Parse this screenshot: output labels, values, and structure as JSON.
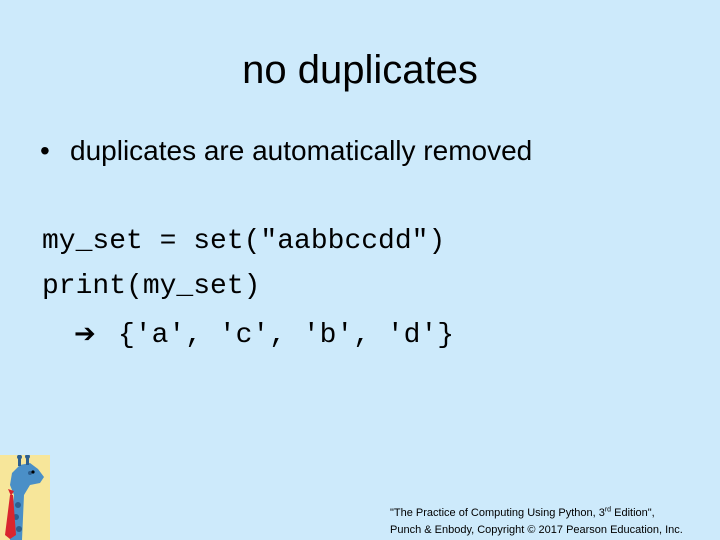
{
  "slide": {
    "title": "no duplicates",
    "bullets": [
      {
        "text": "duplicates are automatically removed"
      }
    ],
    "code": {
      "line1": "my_set = set(\"aabbccdd\")",
      "line2": "print(my_set)",
      "arrow_icon": "right-arrow-icon",
      "output": "{'a', 'c', 'b', 'd'}"
    },
    "logo_icon": "giraffe-logo-icon",
    "footer": {
      "line1_prefix": "\"The Practice of Computing Using Python, 3",
      "line1_sup": "rd",
      "line1_suffix": " Edition\",",
      "line2": "Punch & Enbody, Copyright © 2017 Pearson Education, Inc."
    },
    "colors": {
      "background": "#cdeafb",
      "logo_yellow": "#f7e69a",
      "logo_blue": "#4a8fc7",
      "logo_red": "#d9262e"
    }
  }
}
